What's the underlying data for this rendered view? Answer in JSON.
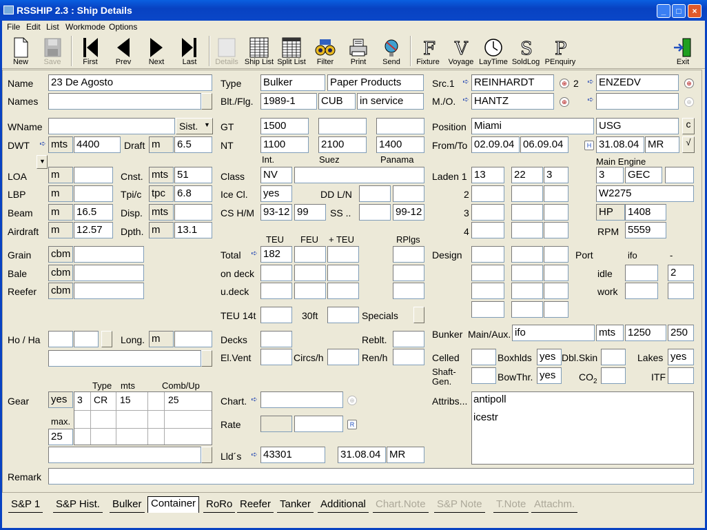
{
  "window": {
    "title": "RSSHIP 2.3 : Ship Details",
    "min": "_",
    "max": "□",
    "close": "×"
  },
  "menu": [
    "File",
    "Edit",
    "List",
    "Workmode",
    "Options"
  ],
  "toolbar": {
    "new": "New",
    "save": "Save",
    "first": "First",
    "prev": "Prev",
    "next": "Next",
    "last": "Last",
    "details": "Details",
    "shiplist": "Ship List",
    "splitlist": "Split List",
    "filter": "Filter",
    "print": "Print",
    "send": "Send",
    "fixture": "Fixture",
    "voyage": "Voyage",
    "laytime": "LayTime",
    "soldlog": "SoldLog",
    "penquiry": "PEnquiry",
    "exit": "Exit"
  },
  "labels": {
    "name": "Name",
    "names": "Names",
    "type": "Type",
    "blt": "Blt./Flg.",
    "src1": "Src.1",
    "mo": "M./O.",
    "two": "2",
    "wname": "WName",
    "sist": "Sist.",
    "dwt": "DWT",
    "draft": "Draft",
    "gt": "GT",
    "nt": "NT",
    "int": "Int.",
    "suez": "Suez",
    "panama": "Panama",
    "position": "Position",
    "fromto": "From/To",
    "c": "c",
    "check": "√",
    "loa": "LOA",
    "lbp": "LBP",
    "beam": "Beam",
    "airdraft": "Airdraft",
    "cnst": "Cnst.",
    "tpic": "Tpi/c",
    "disp": "Disp.",
    "dpth": "Dpth.",
    "class": "Class",
    "icecl": "Ice Cl.",
    "ddln": "DD L/N",
    "cshm": "CS H/M",
    "ss": "SS ..",
    "laden1": "Laden  1",
    "laden2": "2",
    "laden3": "3",
    "laden4": "4",
    "mainengine": "Main Engine",
    "hp": "HP",
    "rpm": "RPM",
    "grain": "Grain",
    "bale": "Bale",
    "reefer": "Reefer",
    "teu": "TEU",
    "feu": "FEU",
    "plusteu": "+ TEU",
    "rplgs": "RPlgs",
    "total": "Total",
    "ondeck": "on deck",
    "udeck": "u.deck",
    "teu14t": "TEU 14t",
    "ft30": "30ft",
    "specials": "Specials",
    "design": "Design",
    "port": "Port",
    "ifo": "ifo",
    "dash": "-",
    "idle": "idle",
    "work": "work",
    "hoha": "Ho / Ha",
    "long": "Long.",
    "decks": "Decks",
    "reblt": "Reblt.",
    "elvent": "El.Vent",
    "circsh": "Circs/h",
    "renh": "Ren/h",
    "bunker": "Bunker",
    "mainaux": "Main/Aux.",
    "celled": "Celled",
    "boxhlds": "Boxhlds",
    "dblskin": "Dbl.Skin",
    "lakes": "Lakes",
    "shaftgen": "Shaft-\nGen.",
    "bowthr": "BowThr.",
    "co2": "CO",
    "itf": "ITF",
    "gtype": "Type",
    "gmts": "mts",
    "gcomb": "Comb/Up",
    "gear": "Gear",
    "max": "max.",
    "chart": "Chart.",
    "rate": "Rate",
    "llds": "Lld´s",
    "attribs": "Attribs...",
    "remark": "Remark",
    "m": "m",
    "mts": "mts",
    "tpc": "tpc",
    "cbm": "cbm"
  },
  "values": {
    "name": "23 De Agosto",
    "type1": "Bulker",
    "type2": "Paper Products",
    "src1": "REINHARDT",
    "src2": "ENZEDV",
    "mo": "HANTZ",
    "blt": "1989-1",
    "flag": "CUB",
    "status": "in service",
    "dwt": "4400",
    "draft": "6.5",
    "gt": "1500",
    "nt": "1100",
    "nt_suez": "2100",
    "nt_panama": "1400",
    "position": "Miami",
    "position2": "USG",
    "from": "02.09.04",
    "to": "06.09.04",
    "date2": "31.08.04",
    "mr": "MR",
    "beam": "16.5",
    "airdraft": "12.57",
    "cnst": "51",
    "tpic": "6.8",
    "dpth": "13.1",
    "class": "NV",
    "icecl": "yes",
    "cs_h": "93-12",
    "cs_m": "99",
    "ss": "99-12",
    "laden1a": "13",
    "laden1b": "22",
    "laden1c": "3",
    "me1": "3",
    "me2": "GEC",
    "me3": "W2275",
    "hp": "1408",
    "rpm": "5559",
    "teu_total": "182",
    "ifo_port": "2",
    "bunker_type": "ifo",
    "bunker_unit": "mts",
    "bunker_main": "1250",
    "bunker_aux": "250",
    "boxhlds": "yes",
    "lakes": "yes",
    "bowthr": "yes",
    "gear": "yes",
    "gear_n": "3",
    "gear_type": "CR",
    "gear_mts": "15",
    "gear_comb": "25",
    "gear_max": "25",
    "llds": "43301",
    "llds_date": "31.08.04",
    "llds_mr": "MR",
    "attrib1": "antipoll",
    "attrib2": "icestr"
  },
  "tabs": [
    {
      "label": "S&P 1",
      "state": "normal"
    },
    {
      "label": "S&P Hist.",
      "state": "normal"
    },
    {
      "label": "Bulker",
      "state": "normal"
    },
    {
      "label": "Container",
      "state": "active"
    },
    {
      "label": "RoRo",
      "state": "normal"
    },
    {
      "label": "Reefer",
      "state": "normal"
    },
    {
      "label": "Tanker",
      "state": "normal"
    },
    {
      "label": "Additional",
      "state": "normal"
    },
    {
      "label": "Chart.Note",
      "state": "disabled"
    },
    {
      "label": "S&P Note",
      "state": "disabled"
    },
    {
      "label": "T.Note",
      "state": "disabled"
    },
    {
      "label": "Attachm.",
      "state": "disabled"
    }
  ]
}
